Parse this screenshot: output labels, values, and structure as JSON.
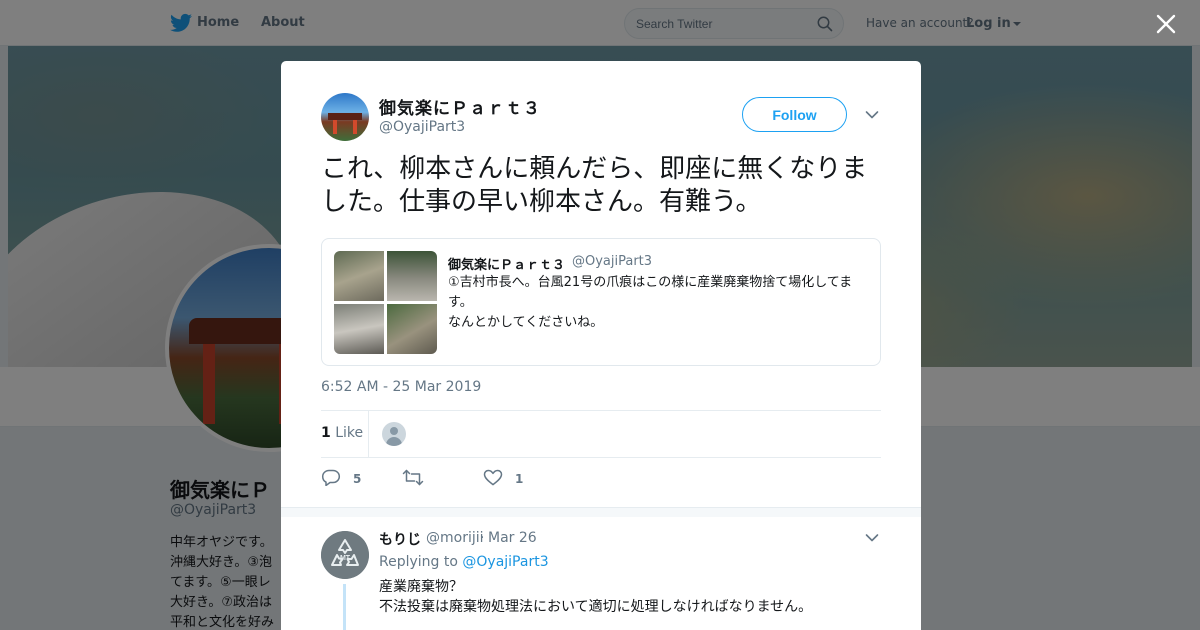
{
  "nav": {
    "home_label": "Home",
    "about_label": "About",
    "search_placeholder": "Search Twitter",
    "have_account": "Have an account?",
    "login_label": "Log in"
  },
  "profile_bg": {
    "name": "御気楽にＰ",
    "handle": "@OyajiPart3",
    "bio_lines": [
      "中年オヤジです。",
      "沖縄大好き。③泡",
      "てます。⑤一眼レ",
      "大好き。⑦政治は",
      "平和と文化を好み"
    ]
  },
  "tweet": {
    "author_name": "御気楽にＰａｒｔ３",
    "author_handle": "@OyajiPart3",
    "follow_label": "Follow",
    "text": "これ、柳本さんに頼んだら、即座に無くなりました。仕事の早い柳本さん。有難う。",
    "quote": {
      "name": "御気楽にＰａｒｔ３",
      "handle": "@OyajiPart3",
      "text_line1": "①吉村市長へ。台風21号の爪痕はこの様に産業廃棄物捨て場化してます。",
      "text_line2": "なんとかしてくださいね。"
    },
    "timestamp": "6:52 AM - 25 Mar 2019",
    "like_count": "1",
    "like_label": "Like",
    "actions": {
      "reply_count": "5",
      "retweet_count": "",
      "like_count": "1"
    }
  },
  "reply": {
    "name": "もりじ",
    "handle": "@morijii",
    "separator": "·",
    "date": "Mar 26",
    "replying_prefix": "Replying to",
    "replying_to": "@OyajiPart3",
    "text_line1": "産業廃棄物？",
    "text_line2": "不法投棄は廃棄物処理法において適切に処理しなければなりません。"
  },
  "colors": {
    "twitter_blue": "#1da1f2",
    "link_blue": "#1b95e0",
    "secondary_text": "#657786"
  },
  "icons": [
    "twitter-bird-icon",
    "search-icon",
    "close-icon",
    "chevron-down-icon",
    "reply-icon",
    "retweet-icon",
    "heart-icon",
    "recycle-avatar-icon"
  ]
}
